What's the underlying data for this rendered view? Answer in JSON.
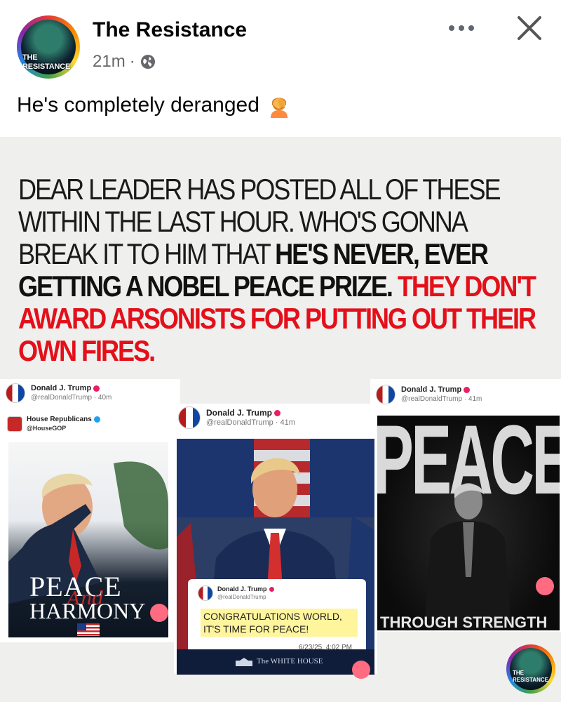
{
  "post": {
    "page_name": "The Resistance",
    "time": "21m",
    "separator": "·",
    "caption": "He's completely deranged",
    "avatar_text_line1": "THE",
    "avatar_text_line2": "RESISTANCE"
  },
  "meme": {
    "headline_plain": "DEAR LEADER HAS POSTED ALL OF THESE WITHIN THE LAST HOUR. WHO'S GONNA BREAK IT TO HIM THAT ",
    "headline_bold": "HE'S NEVER, EVER GETTING A NOBEL PEACE PRIZE.",
    "headline_red": "THEY DON'T AWARD ARSONISTS FOR PUTTING OUT THEIR OWN FIRES.",
    "card_left": {
      "author": "Donald J. Trump",
      "handle": "@realDonaldTrump · 40m",
      "repost_author": "House Republicans",
      "repost_handle": "@HouseGOP",
      "title_line1": "PEACE",
      "title_script": "And",
      "title_line2": "HARMONY"
    },
    "card_center": {
      "author": "Donald J. Trump",
      "handle": "@realDonaldTrump · 41m",
      "quote_author": "Donald J. Trump",
      "quote_handle": "@realDonaldTrump",
      "quote_text": "CONGRATULATIONS WORLD, IT'S TIME FOR PEACE!",
      "quote_time": "6/23/25, 4:02 PM",
      "footer": "The WHITE HOUSE"
    },
    "card_right": {
      "author": "Donald J. Trump",
      "handle": "@realDonaldTrump · 41m",
      "title_top": "PEACE",
      "title_bottom": "THROUGH STRENGTH"
    },
    "corner_logo_line1": "THE",
    "corner_logo_line2": "RESISTANCE"
  },
  "colors": {
    "headline_red": "#e3101a",
    "verified_badge": "#e91e63",
    "quote_highlight": "#fff59d"
  }
}
